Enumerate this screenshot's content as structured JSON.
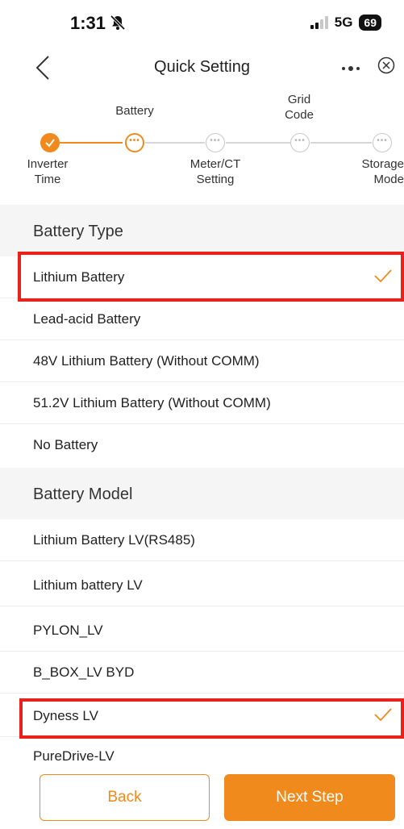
{
  "status": {
    "time": "1:31",
    "network": "5G",
    "battery": "69",
    "icons": [
      "bell-slash-icon",
      "signal-icon",
      "battery-icon"
    ]
  },
  "nav": {
    "title": "Quick Setting",
    "back_icon": "chevron-left-icon",
    "more_icon": "more-dots-icon",
    "close_icon": "close-circle-icon"
  },
  "stepper": {
    "steps": [
      {
        "label": "Inverter Time",
        "state": "done"
      },
      {
        "label": "Battery",
        "state": "current"
      },
      {
        "label": "Meter/CT Setting",
        "state": "todo"
      },
      {
        "label": "Grid Code",
        "state": "todo"
      },
      {
        "label": "Storage Mode",
        "state": "todo"
      }
    ]
  },
  "battery_type": {
    "header": "Battery Type",
    "items": [
      {
        "label": "Lithium Battery",
        "selected": true
      },
      {
        "label": "Lead-acid Battery",
        "selected": false
      },
      {
        "label": "48V Lithium Battery (Without COMM)",
        "selected": false
      },
      {
        "label": "51.2V Lithium Battery (Without COMM)",
        "selected": false
      },
      {
        "label": "No Battery",
        "selected": false
      }
    ]
  },
  "battery_model": {
    "header": "Battery Model",
    "items": [
      {
        "label": "Lithium Battery LV(RS485)",
        "selected": false
      },
      {
        "label": "Lithium battery LV",
        "selected": false
      },
      {
        "label": "PYLON_LV",
        "selected": false
      },
      {
        "label": "B_BOX_LV BYD",
        "selected": false
      },
      {
        "label": "Dyness LV",
        "selected": true
      },
      {
        "label": "PureDrive-LV",
        "selected": false
      }
    ]
  },
  "footer": {
    "back_label": "Back",
    "next_label": "Next Step"
  },
  "colors": {
    "accent": "#f08a1c",
    "highlight": "#e8221b"
  }
}
